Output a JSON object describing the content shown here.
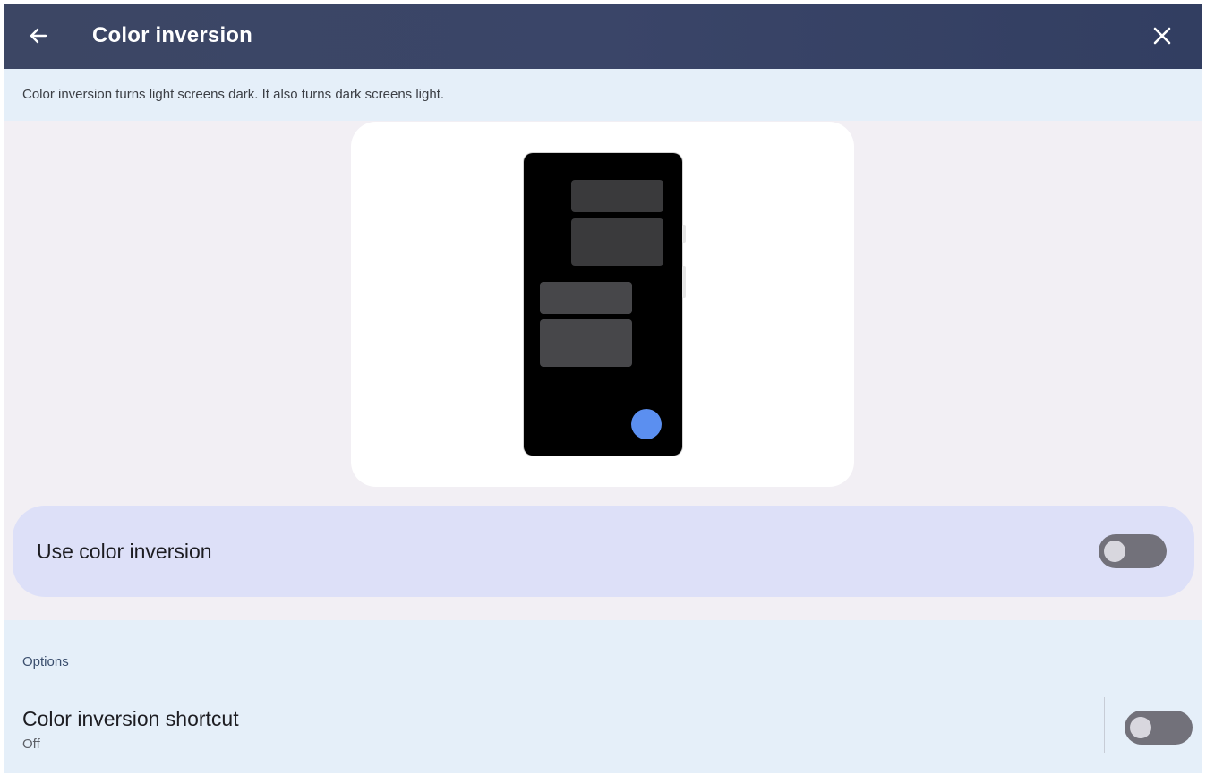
{
  "header": {
    "title": "Color inversion",
    "back_icon": "arrow-left-icon",
    "close_icon": "close-icon",
    "background": "#3a4568"
  },
  "description": "Color inversion turns light screens dark. It also turns dark screens light.",
  "preview": {
    "illustration": "phone-illustration-dark",
    "fab_color": "#5b8ff0"
  },
  "main_toggle": {
    "label": "Use color inversion",
    "checked": false
  },
  "options": {
    "header": "Options",
    "shortcut": {
      "title": "Color inversion shortcut",
      "subtitle": "Off",
      "checked": false
    }
  }
}
